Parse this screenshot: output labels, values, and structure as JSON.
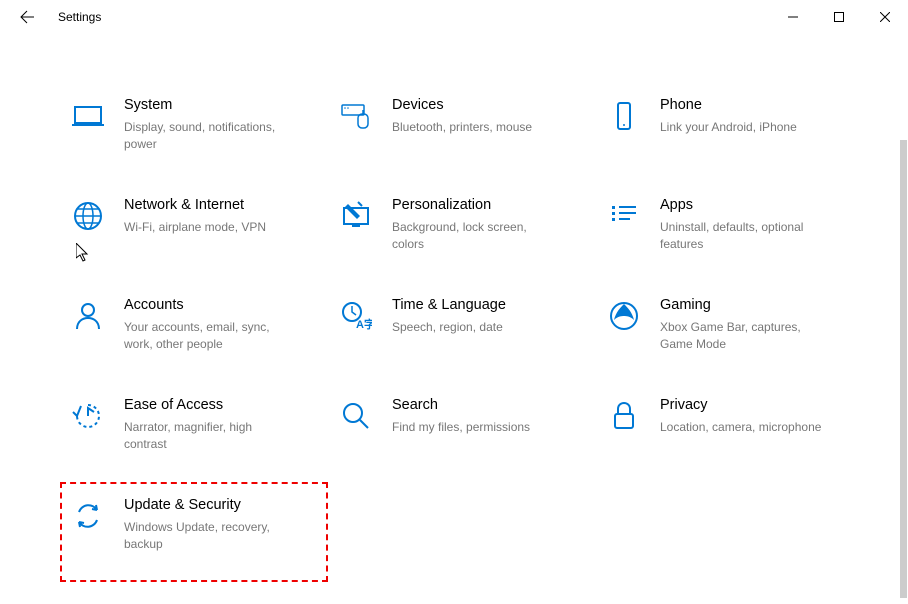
{
  "window": {
    "title": "Settings"
  },
  "tiles": [
    {
      "title": "System",
      "desc": "Display, sound, notifications, power"
    },
    {
      "title": "Devices",
      "desc": "Bluetooth, printers, mouse"
    },
    {
      "title": "Phone",
      "desc": "Link your Android, iPhone"
    },
    {
      "title": "Network & Internet",
      "desc": "Wi-Fi, airplane mode, VPN"
    },
    {
      "title": "Personalization",
      "desc": "Background, lock screen, colors"
    },
    {
      "title": "Apps",
      "desc": "Uninstall, defaults, optional features"
    },
    {
      "title": "Accounts",
      "desc": "Your accounts, email, sync, work, other people"
    },
    {
      "title": "Time & Language",
      "desc": "Speech, region, date"
    },
    {
      "title": "Gaming",
      "desc": "Xbox Game Bar, captures, Game Mode"
    },
    {
      "title": "Ease of Access",
      "desc": "Narrator, magnifier, high contrast"
    },
    {
      "title": "Search",
      "desc": "Find my files, permissions"
    },
    {
      "title": "Privacy",
      "desc": "Location, camera, microphone"
    },
    {
      "title": "Update & Security",
      "desc": "Windows Update, recovery, backup"
    }
  ],
  "highlighted_index": 12,
  "accent": "#0078d4"
}
